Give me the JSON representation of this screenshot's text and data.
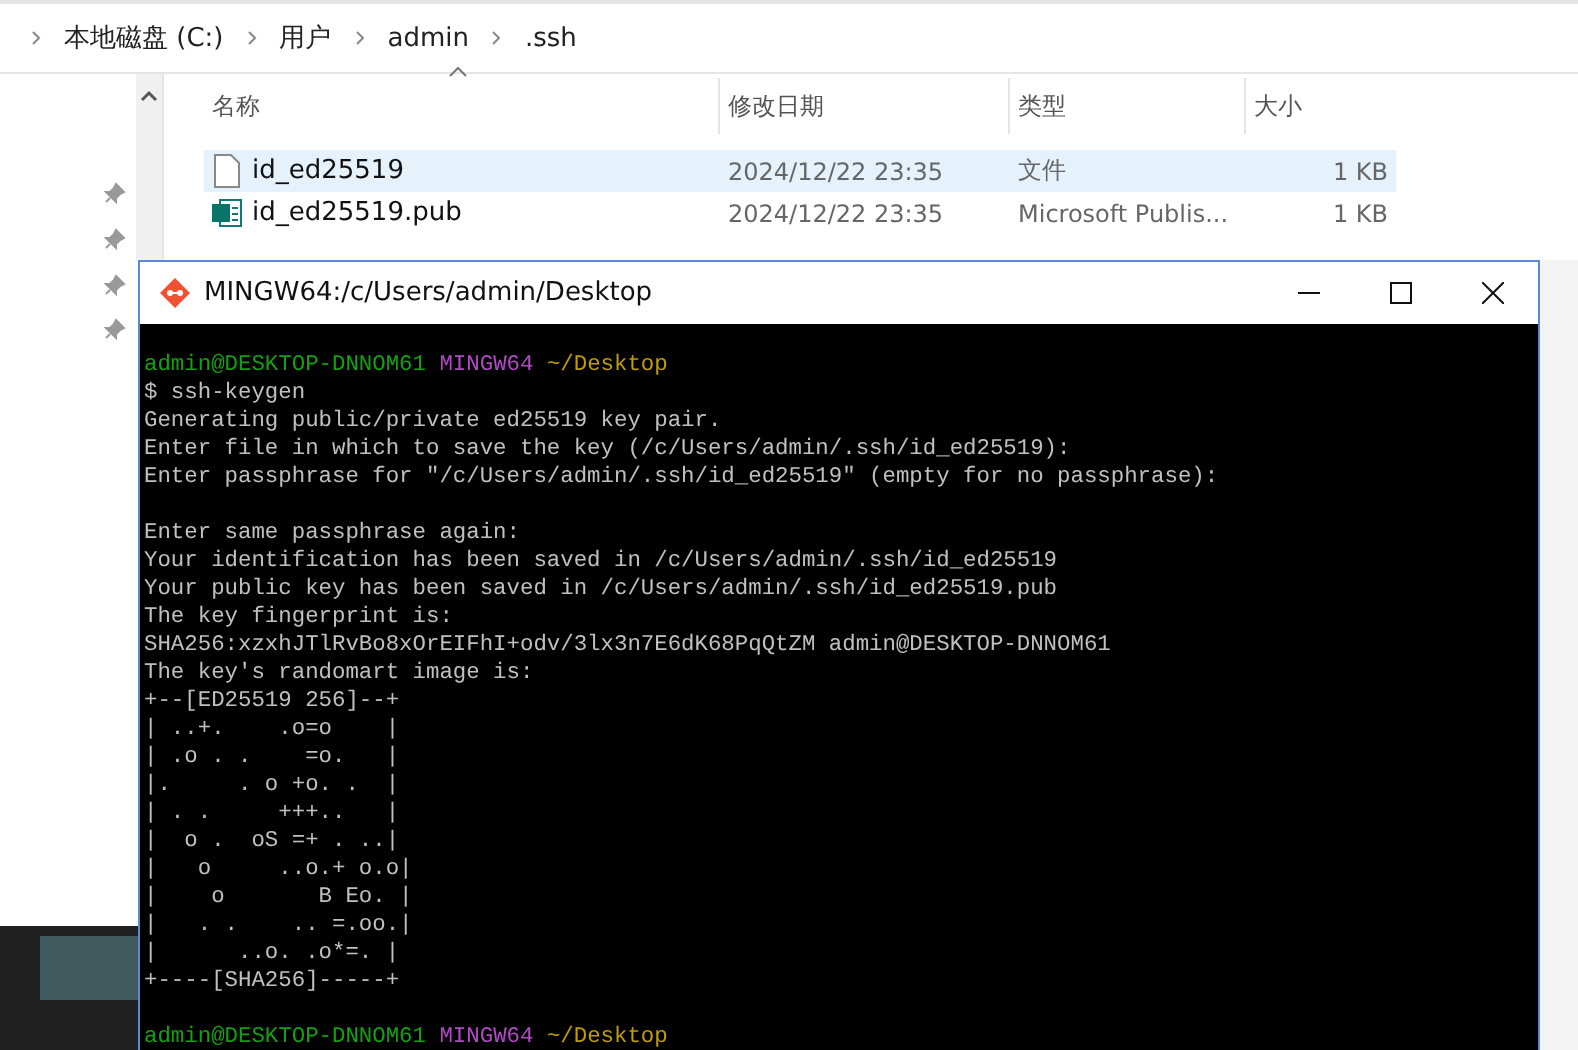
{
  "explorer": {
    "breadcrumb": [
      "本地磁盘 (C:)",
      "用户",
      "admin",
      ".ssh"
    ],
    "columns": [
      "名称",
      "修改日期",
      "类型",
      "大小"
    ],
    "files": [
      {
        "name": "id_ed25519",
        "modified": "2024/12/22 23:35",
        "type": "文件",
        "size": "1 KB",
        "kind": "file",
        "selected": true
      },
      {
        "name": "id_ed25519.pub",
        "modified": "2024/12/22 23:35",
        "type": "Microsoft Publis...",
        "size": "1 KB",
        "kind": "publisher",
        "selected": false
      }
    ]
  },
  "terminal": {
    "title": "MINGW64:/c/Users/admin/Desktop",
    "lines": [
      {
        "kind": "blank"
      },
      {
        "kind": "prompt",
        "user": "admin@DESKTOP-DNNOM61",
        "shell": "MINGW64",
        "path": "~/Desktop"
      },
      {
        "kind": "text",
        "text": "$ ssh-keygen"
      },
      {
        "kind": "text",
        "text": "Generating public/private ed25519 key pair."
      },
      {
        "kind": "text",
        "text": "Enter file in which to save the key (/c/Users/admin/.ssh/id_ed25519):"
      },
      {
        "kind": "text",
        "text": "Enter passphrase for \"/c/Users/admin/.ssh/id_ed25519\" (empty for no passphrase):"
      },
      {
        "kind": "blank"
      },
      {
        "kind": "text",
        "text": "Enter same passphrase again:"
      },
      {
        "kind": "text",
        "text": "Your identification has been saved in /c/Users/admin/.ssh/id_ed25519"
      },
      {
        "kind": "text",
        "text": "Your public key has been saved in /c/Users/admin/.ssh/id_ed25519.pub"
      },
      {
        "kind": "text",
        "text": "The key fingerprint is:"
      },
      {
        "kind": "text",
        "text": "SHA256:xzxhJTlRvBo8xOrEIFhI+odv/3lx3n7E6dK68PqQtZM admin@DESKTOP-DNNOM61"
      },
      {
        "kind": "text",
        "text": "The key's randomart image is:"
      },
      {
        "kind": "text",
        "text": "+--[ED25519 256]--+"
      },
      {
        "kind": "text",
        "text": "| ..+.    .o=o    |"
      },
      {
        "kind": "text",
        "text": "| .o . .    =o.   |"
      },
      {
        "kind": "text",
        "text": "|.     . o +o. .  |"
      },
      {
        "kind": "text",
        "text": "| . .     +++..   |"
      },
      {
        "kind": "text",
        "text": "|  o .  oS =+ . ..|"
      },
      {
        "kind": "text",
        "text": "|   o     ..o.+ o.o|"
      },
      {
        "kind": "text",
        "text": "|    o       B Eo. |"
      },
      {
        "kind": "text",
        "text": "|   . .    .. =.oo.|"
      },
      {
        "kind": "text",
        "text": "|      ..o. .o*=. |"
      },
      {
        "kind": "text",
        "text": "+----[SHA256]-----+"
      },
      {
        "kind": "blank"
      },
      {
        "kind": "prompt",
        "user": "admin@DESKTOP-DNNOM61",
        "shell": "MINGW64",
        "path": "~/Desktop"
      }
    ]
  }
}
